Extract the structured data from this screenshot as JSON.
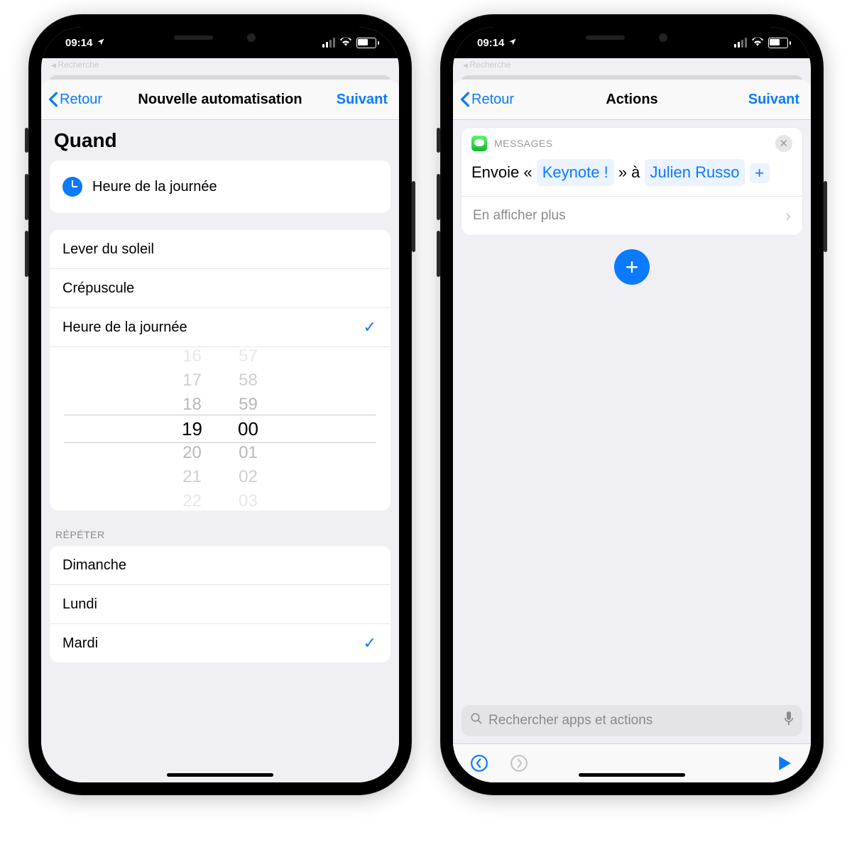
{
  "status": {
    "time": "09:14",
    "back_app": "Recherche"
  },
  "left": {
    "nav": {
      "back": "Retour",
      "title": "Nouvelle automatisation",
      "next": "Suivant"
    },
    "section_title": "Quand",
    "selected_option": "Heure de la journée",
    "options": [
      "Lever du soleil",
      "Crépuscule",
      "Heure de la journée"
    ],
    "selected_index": 2,
    "picker": {
      "hours": [
        "16",
        "17",
        "18",
        "19",
        "20",
        "21",
        "22"
      ],
      "minutes": [
        "57",
        "58",
        "59",
        "00",
        "01",
        "02",
        "03"
      ],
      "selected_hour": "19",
      "selected_minute": "00"
    },
    "repeat_header": "RÉPÉTER",
    "days": [
      "Dimanche",
      "Lundi",
      "Mardi"
    ],
    "days_checked": [
      false,
      false,
      true
    ]
  },
  "right": {
    "nav": {
      "back": "Retour",
      "title": "Actions",
      "next": "Suivant"
    },
    "action": {
      "app_label": "MESSAGES",
      "prefix": "Envoie « ",
      "token1": "Keynote !",
      "mid": " » à ",
      "token2": "Julien Russo",
      "more_label": "En afficher plus"
    },
    "search_placeholder": "Rechercher apps et actions"
  }
}
